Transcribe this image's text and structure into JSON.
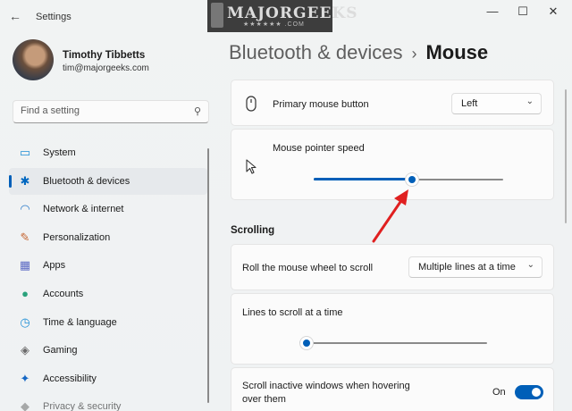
{
  "window": {
    "title": "Settings",
    "controls": {
      "minimize": "—",
      "maximize": "☐",
      "close": "✕"
    }
  },
  "watermark": {
    "text": "MAJORGEEKS",
    "stars": "★★★★★★ .COM"
  },
  "profile": {
    "name": "Timothy Tibbetts",
    "email": "tim@majorgeeks.com"
  },
  "search": {
    "placeholder": "Find a setting",
    "icon": "search-icon"
  },
  "sidebar": {
    "items": [
      {
        "label": "System",
        "icon": "system-icon",
        "glyph": "▭",
        "color": "#1f8fd6",
        "active": false
      },
      {
        "label": "Bluetooth & devices",
        "icon": "bluetooth-icon",
        "glyph": "✱",
        "color": "#0067c0",
        "active": true
      },
      {
        "label": "Network & internet",
        "icon": "wifi-icon",
        "glyph": "◠",
        "color": "#2a79c9",
        "active": false
      },
      {
        "label": "Personalization",
        "icon": "brush-icon",
        "glyph": "✎",
        "color": "#c4622d",
        "active": false
      },
      {
        "label": "Apps",
        "icon": "apps-icon",
        "glyph": "▦",
        "color": "#5c6ac4",
        "active": false
      },
      {
        "label": "Accounts",
        "icon": "person-icon",
        "glyph": "●",
        "color": "#2aa27c",
        "active": false
      },
      {
        "label": "Time & language",
        "icon": "globe-clock-icon",
        "glyph": "◷",
        "color": "#1f8fd6",
        "active": false
      },
      {
        "label": "Gaming",
        "icon": "gamepad-icon",
        "glyph": "◈",
        "color": "#6b6b6b",
        "active": false
      },
      {
        "label": "Accessibility",
        "icon": "accessibility-icon",
        "glyph": "✦",
        "color": "#1668c4",
        "active": false
      },
      {
        "label": "Privacy & security",
        "icon": "shield-icon",
        "glyph": "◆",
        "color": "#777777",
        "active": false
      }
    ]
  },
  "breadcrumb": {
    "parent": "Bluetooth & devices",
    "separator": "›",
    "current": "Mouse"
  },
  "main": {
    "primary_button": {
      "label": "Primary mouse button",
      "value": "Left",
      "icon": "mouse-icon"
    },
    "pointer_speed": {
      "label": "Mouse pointer speed",
      "value_fraction": 0.52,
      "icon": "pointer-icon"
    },
    "scrolling_section": "Scrolling",
    "roll_wheel": {
      "label": "Roll the mouse wheel to scroll",
      "value": "Multiple lines at a time"
    },
    "lines_to_scroll": {
      "label": "Lines to scroll at a time",
      "value_fraction": 0.04
    },
    "scroll_inactive": {
      "label_line1": "Scroll inactive windows when hovering",
      "label_line2": "over them",
      "state": "On"
    }
  },
  "colors": {
    "accent": "#005fb8",
    "annotation_arrow": "#e02020"
  }
}
